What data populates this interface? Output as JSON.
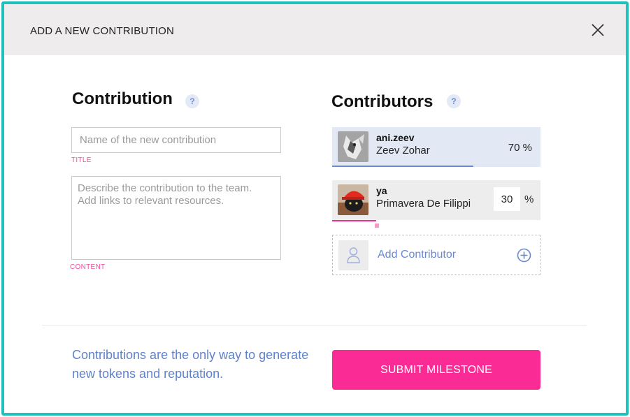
{
  "modal": {
    "title": "ADD A NEW CONTRIBUTION",
    "close_icon": "close-icon"
  },
  "contribution": {
    "heading": "Contribution",
    "help": "?",
    "title_placeholder": "Name of the new contribution",
    "title_label": "TITLE",
    "content_placeholder": "Describe the contribution to the team.\nAdd links to relevant resources.",
    "content_label": "CONTENT"
  },
  "contributors": {
    "heading": "Contributors",
    "help": "?",
    "list": [
      {
        "username": "ani.zeev",
        "name": "Zeev Zohar",
        "share": "70",
        "share_display": "70 %",
        "avatar_icon": "wolf-avatar",
        "share_fraction": 0.7
      },
      {
        "username": "ya",
        "name": "Primavera De Filippi",
        "share": "30",
        "share_sign": "%",
        "avatar_icon": "red-hat-cat-avatar",
        "share_fraction": 0.3
      }
    ],
    "add_label": "Add Contributor",
    "add_icon": "plus-circle-icon",
    "add_avatar_icon": "user-icon"
  },
  "footer": {
    "note": "Contributions are the only way to generate new tokens and reputation.",
    "submit_label": "SUBMIT MILESTONE"
  },
  "colors": {
    "border_accent": "#22c0bd",
    "primary_pink": "#fa2b94",
    "link_blue": "#6a89d1",
    "label_pink": "#ee4fa0"
  }
}
